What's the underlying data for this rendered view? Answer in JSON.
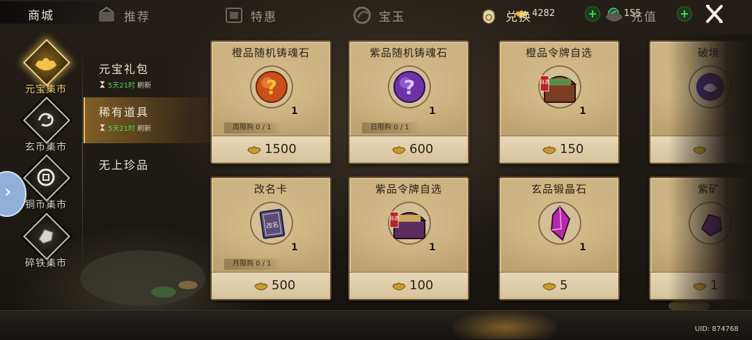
{
  "header": {
    "title": "商城",
    "currencies": [
      {
        "icon": "gold-ingot-icon",
        "value": "4282"
      },
      {
        "icon": "jade-coin-icon",
        "value": "155"
      }
    ]
  },
  "categories": [
    {
      "label": "元宝集市",
      "icon": "gold-ingot-icon",
      "active": true
    },
    {
      "label": "玄币集市",
      "icon": "dragon-coin-icon",
      "active": false
    },
    {
      "label": "铜币集市",
      "icon": "copper-coin-icon",
      "active": false
    },
    {
      "label": "碎铁集市",
      "icon": "iron-icon",
      "active": false
    }
  ],
  "subcategories": [
    {
      "label": "元宝礼包",
      "timer_green": "5天21时",
      "timer_suffix": "刷新"
    },
    {
      "label": "稀有道具",
      "timer_green": "5天21时",
      "timer_suffix": "刷新",
      "active": true
    },
    {
      "label": "无上珍品"
    }
  ],
  "items": [
    {
      "name": "橙品随机铸魂石",
      "qty": "1",
      "limit": "周限购 0 / 1",
      "price": "1500",
      "icon": "orange-soul-stone-icon",
      "color": "#d0581f"
    },
    {
      "name": "紫品随机铸魂石",
      "qty": "1",
      "limit": "日限购 0 / 1",
      "price": "600",
      "icon": "purple-soul-stone-icon",
      "color": "#7a3fb0"
    },
    {
      "name": "橙品令牌自选",
      "qty": "1",
      "limit": "",
      "price": "150",
      "icon": "orange-token-chest-icon"
    },
    {
      "name": "破境",
      "qty": "",
      "limit": "",
      "price": "",
      "icon": "breakthrough-item-icon"
    },
    {
      "name": "改名卡",
      "qty": "1",
      "limit": "月限购 0 / 1",
      "price": "500",
      "icon": "rename-card-icon"
    },
    {
      "name": "紫品令牌自选",
      "qty": "1",
      "limit": "",
      "price": "100",
      "icon": "purple-token-chest-icon"
    },
    {
      "name": "玄品锻晶石",
      "qty": "1",
      "limit": "",
      "price": "5",
      "icon": "forge-crystal-icon",
      "color": "#c02fb8"
    },
    {
      "name": "紫矿",
      "qty": "",
      "limit": "",
      "price": "1",
      "icon": "purple-ore-icon"
    }
  ],
  "chest_label": "自选",
  "rename_label": "改名",
  "tabs": [
    {
      "label": "推荐",
      "icon": "recommend-icon"
    },
    {
      "label": "特惠",
      "icon": "discount-icon"
    },
    {
      "label": "宝玉",
      "icon": "jade-icon"
    },
    {
      "label": "兑换",
      "icon": "exchange-bag-icon",
      "active": true
    },
    {
      "label": "充值",
      "icon": "recharge-icon"
    }
  ],
  "uid": "UID: 874768",
  "colors": {
    "accent_gold": "#f3cf6e",
    "plus_green": "#43e047",
    "timer_green": "#57d34b"
  }
}
